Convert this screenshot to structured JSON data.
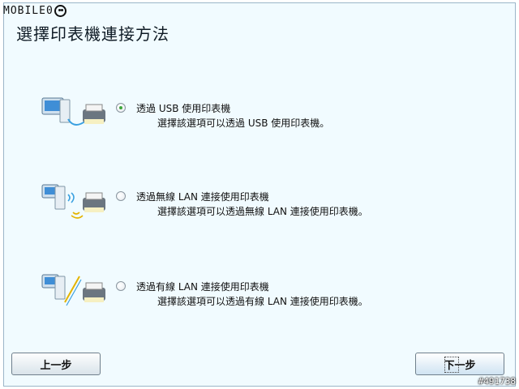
{
  "watermark_logo": "MOBILE01",
  "title": "選擇印表機連接方法",
  "options": [
    {
      "label": "透過 USB 使用印表機",
      "description": "選擇該選項可以透過 USB 使用印表機。",
      "selected": true,
      "icon": "usb-printer-icon"
    },
    {
      "label": "透過無線 LAN 連接使用印表機",
      "description": "選擇該選項可以透過無線 LAN 連接使用印表機。",
      "selected": false,
      "icon": "wireless-printer-icon"
    },
    {
      "label": "透過有線 LAN 連接使用印表機",
      "description": "選擇該選項可以透過有線 LAN 連接使用印表機。",
      "selected": false,
      "icon": "wired-printer-icon"
    }
  ],
  "buttons": {
    "back": "上一步",
    "next": "下一步"
  },
  "watermark_id": "#491738",
  "colors": {
    "background": "#f1fbff",
    "radio_selected": "#3ea63c"
  }
}
